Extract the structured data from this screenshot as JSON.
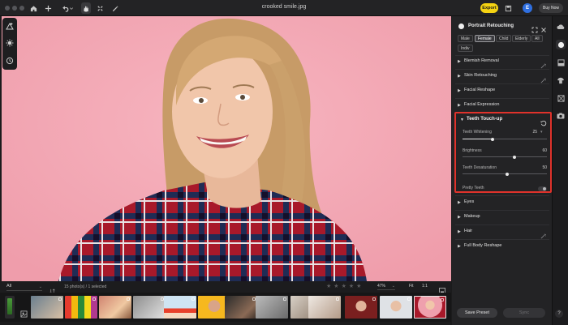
{
  "app": {
    "title": "crooked smile.jpg"
  },
  "toolbar": {
    "export_label": "Export",
    "avatar_letter": "E",
    "buy_now_label": "Buy Now"
  },
  "filmstrip": {
    "filter_value": "All",
    "photo_count": "15 photo(s) / 1 selected",
    "zoom_value": "47%",
    "fit_label": "Fit",
    "one_to_one_label": "1:1",
    "rating_stars": 5
  },
  "panel": {
    "title": "Portrait Retouching",
    "chips": [
      "Male",
      "Female",
      "Child",
      "Elderly",
      "All",
      "Indiv"
    ],
    "selected_chip": "Female",
    "sections_top": [
      {
        "label": "Blemish Removal"
      },
      {
        "label": "Skin Retouching"
      },
      {
        "label": "Facial Reshape"
      },
      {
        "label": "Facial Expression"
      }
    ],
    "teeth": {
      "title": "Teeth Touch-up",
      "sliders": [
        {
          "label": "Teeth Whitening",
          "value": "25",
          "fraction": 0.36
        },
        {
          "label": "Brightness",
          "value": "60",
          "fraction": 0.62
        },
        {
          "label": "Teeth Desaturation",
          "value": "50",
          "fraction": 0.53
        }
      ],
      "pretty_teeth_label": "Pretty Teeth",
      "pretty_teeth_on": false
    },
    "sections_bottom": [
      {
        "label": "Eyes"
      },
      {
        "label": "Makeup"
      },
      {
        "label": "Hair"
      },
      {
        "label": "Full Body Reshape"
      }
    ],
    "save_preset_label": "Save Preset",
    "sync_label": "Sync"
  },
  "help_label": "?",
  "colors": {
    "accent_export": "#f5d312",
    "highlight_box": "#e0322b",
    "photo_background": "#f2a8b3",
    "avatar": "#2f6fe0"
  }
}
